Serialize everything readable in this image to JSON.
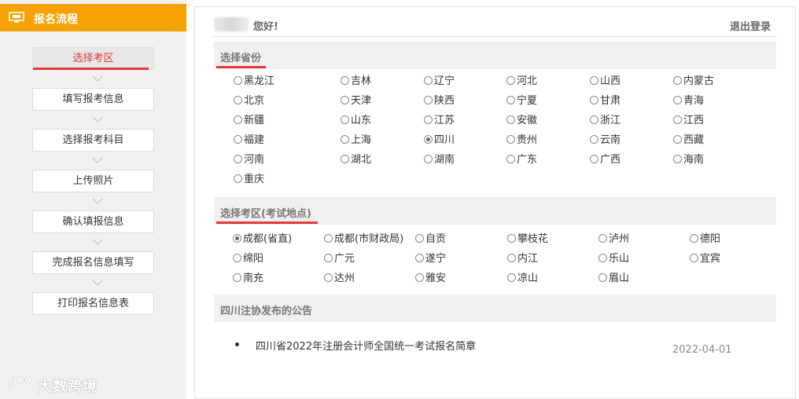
{
  "sidebar": {
    "title": "报名流程",
    "steps": [
      "选择考区",
      "填写报考信息",
      "选择报考科目",
      "上传照片",
      "确认填报信息",
      "完成报名信息填写",
      "打印报名信息表"
    ],
    "active_index": 0,
    "watermark": "大数跨境"
  },
  "header": {
    "greeting": "您好!",
    "logout": "退出登录"
  },
  "province_section": {
    "title": "选择省份",
    "selected": "四川",
    "options": [
      "黑龙江",
      "吉林",
      "辽宁",
      "河北",
      "山西",
      "内蒙古",
      "北京",
      "天津",
      "陕西",
      "宁夏",
      "甘肃",
      "青海",
      "新疆",
      "山东",
      "江苏",
      "安徽",
      "浙江",
      "江西",
      "福建",
      "上海",
      "四川",
      "贵州",
      "云南",
      "西藏",
      "河南",
      "湖北",
      "湖南",
      "广东",
      "广西",
      "海南",
      "重庆"
    ]
  },
  "exam_section": {
    "title": "选择考区(考试地点)",
    "selected": "成都(省直)",
    "options": [
      "成都(省直)",
      "成都(市财政局)",
      "自贡",
      "攀枝花",
      "泸州",
      "德阳",
      "绵阳",
      "广元",
      "遂宁",
      "内江",
      "乐山",
      "宜宾",
      "南充",
      "达州",
      "雅安",
      "凉山",
      "眉山"
    ]
  },
  "notice_section": {
    "title": "四川注协发布的公告",
    "items": [
      {
        "text": "四川省2022年注册会计师全国统一考试报名简章",
        "date": "2022-04-01"
      }
    ]
  },
  "colors": {
    "accent_orange": "#f5a100",
    "accent_red": "#e4393c"
  }
}
